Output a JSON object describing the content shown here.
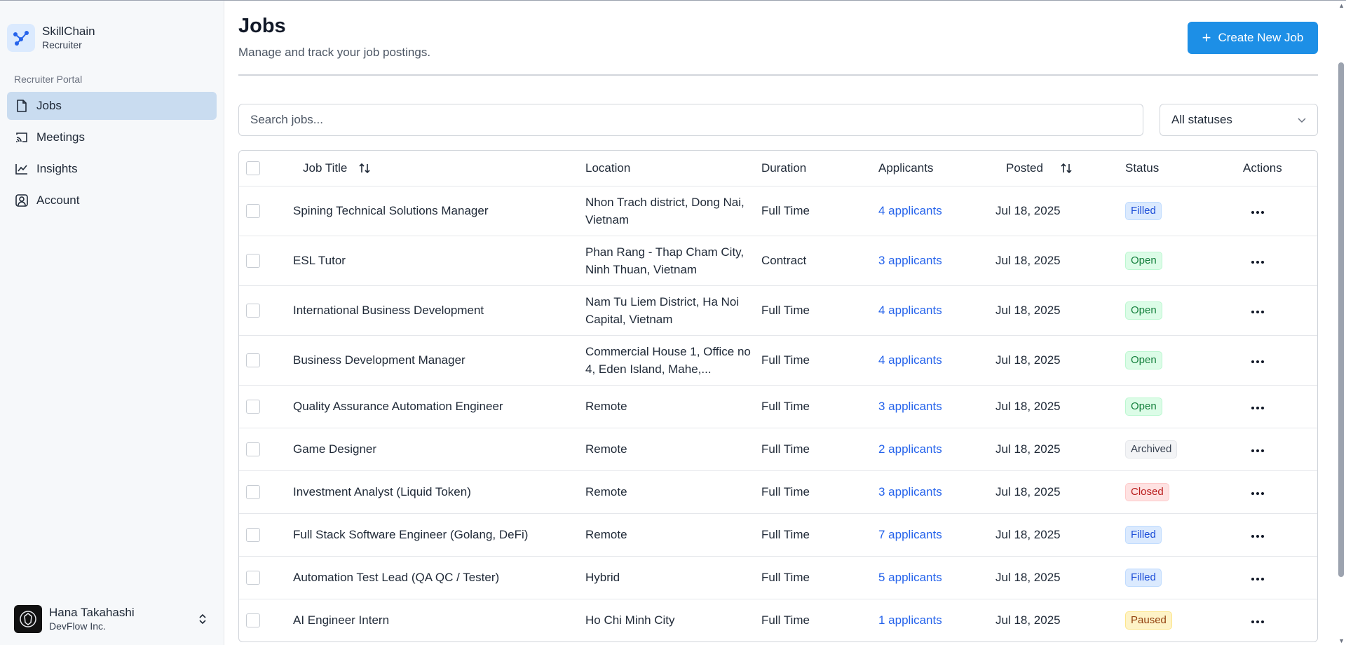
{
  "brand": {
    "name": "SkillChain",
    "sub": "Recruiter"
  },
  "sidebar": {
    "section_label": "Recruiter Portal",
    "items": [
      {
        "label": "Jobs",
        "icon": "file-icon",
        "active": true
      },
      {
        "label": "Meetings",
        "icon": "cast-icon",
        "active": false
      },
      {
        "label": "Insights",
        "icon": "chart-line-icon",
        "active": false
      },
      {
        "label": "Account",
        "icon": "user-square-icon",
        "active": false
      }
    ]
  },
  "user": {
    "name": "Hana Takahashi",
    "org": "DevFlow Inc."
  },
  "header": {
    "title": "Jobs",
    "subtitle": "Manage and track your job postings.",
    "create_label": "Create New Job"
  },
  "filters": {
    "search_placeholder": "Search jobs...",
    "status_value": "All statuses"
  },
  "table": {
    "columns": {
      "title": "Job Title",
      "location": "Location",
      "duration": "Duration",
      "applicants": "Applicants",
      "posted": "Posted",
      "status": "Status",
      "actions": "Actions"
    },
    "rows": [
      {
        "title": "Spining Technical Solutions Manager",
        "location": "Nhon Trach district, Dong Nai, Vietnam",
        "duration": "Full Time",
        "applicants": "4 applicants",
        "posted": "Jul 18, 2025",
        "status": "Filled",
        "status_kind": "filled"
      },
      {
        "title": "ESL Tutor",
        "location": "Phan Rang - Thap Cham City, Ninh Thuan, Vietnam",
        "duration": "Contract",
        "applicants": "3 applicants",
        "posted": "Jul 18, 2025",
        "status": "Open",
        "status_kind": "open"
      },
      {
        "title": "International Business Development",
        "location": "Nam Tu Liem District, Ha Noi Capital, Vietnam",
        "duration": "Full Time",
        "applicants": "4 applicants",
        "posted": "Jul 18, 2025",
        "status": "Open",
        "status_kind": "open"
      },
      {
        "title": "Business Development Manager",
        "location": "Commercial House 1, Office no 4, Eden Island, Mahe,...",
        "duration": "Full Time",
        "applicants": "4 applicants",
        "posted": "Jul 18, 2025",
        "status": "Open",
        "status_kind": "open"
      },
      {
        "title": "Quality Assurance Automation Engineer",
        "location": "Remote",
        "duration": "Full Time",
        "applicants": "3 applicants",
        "posted": "Jul 18, 2025",
        "status": "Open",
        "status_kind": "open"
      },
      {
        "title": "Game Designer",
        "location": "Remote",
        "duration": "Full Time",
        "applicants": "2 applicants",
        "posted": "Jul 18, 2025",
        "status": "Archived",
        "status_kind": "archived"
      },
      {
        "title": "Investment Analyst (Liquid Token)",
        "location": "Remote",
        "duration": "Full Time",
        "applicants": "3 applicants",
        "posted": "Jul 18, 2025",
        "status": "Closed",
        "status_kind": "closed"
      },
      {
        "title": "Full Stack Software Engineer (Golang, DeFi)",
        "location": "Remote",
        "duration": "Full Time",
        "applicants": "7 applicants",
        "posted": "Jul 18, 2025",
        "status": "Filled",
        "status_kind": "filled"
      },
      {
        "title": "Automation Test Lead (QA QC / Tester)",
        "location": "Hybrid",
        "duration": "Full Time",
        "applicants": "5 applicants",
        "posted": "Jul 18, 2025",
        "status": "Filled",
        "status_kind": "filled"
      },
      {
        "title": "AI Engineer Intern",
        "location": "Ho Chi Minh City",
        "duration": "Full Time",
        "applicants": "1 applicants",
        "posted": "Jul 18, 2025",
        "status": "Paused",
        "status_kind": "paused"
      }
    ]
  },
  "colors": {
    "accent": "#1d8fe6",
    "link": "#2563eb",
    "sidebar_active": "#c9dcf0"
  }
}
